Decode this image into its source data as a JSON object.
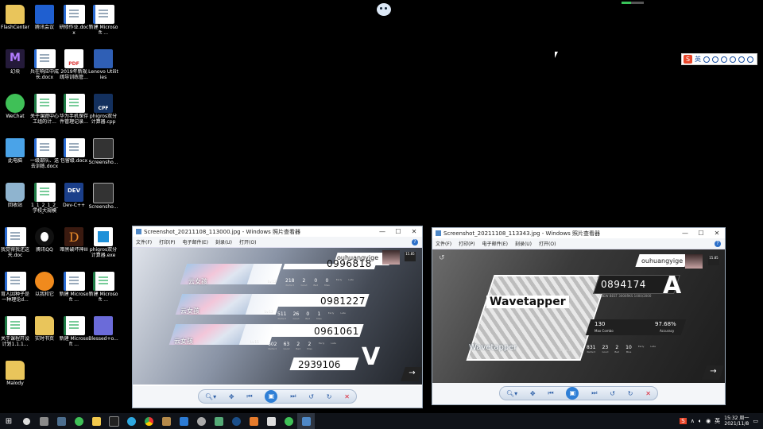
{
  "desktop_icons": [
    {
      "label": "FlashCenter",
      "icon": "flash-folder-icon"
    },
    {
      "label": "腾讯会议",
      "icon": "tencent-meeting-icon"
    },
    {
      "label": "研修作业.docx",
      "icon": "word-doc-icon"
    },
    {
      "label": "新建 Microsoft ...",
      "icon": "word-doc-icon"
    },
    {
      "label": "幻块",
      "icon": "app-icon"
    },
    {
      "label": "兵在响应中成长.docx",
      "icon": "word-doc-icon"
    },
    {
      "label": "2019年新规疏导训练管...",
      "icon": "pdf-icon"
    },
    {
      "label": "Lenovo Utilities",
      "icon": "lenovo-utilities-icon"
    },
    {
      "label": "WeChat",
      "icon": "wechat-icon"
    },
    {
      "label": "关于课题中心工组的计...",
      "icon": "excel-icon"
    },
    {
      "label": "华为手机保存件管理记录...",
      "icon": "excel-icon"
    },
    {
      "label": "phigros双分计算器.cpp",
      "icon": "cpp-file-icon"
    },
    {
      "label": "此电脑",
      "icon": "this-pc-icon"
    },
    {
      "label": "一级部队、送去训练.docx",
      "icon": "word-doc-icon"
    },
    {
      "label": "包留级.docx",
      "icon": "word-doc-icon"
    },
    {
      "label": "Screensho...",
      "icon": "screenshot-icon"
    },
    {
      "label": "回收站",
      "icon": "recycle-bin-icon"
    },
    {
      "label": "1_1_2_1_2_学校大规模投...",
      "icon": "excel-icon"
    },
    {
      "label": "Dev-C++",
      "icon": "dev-cpp-icon"
    },
    {
      "label": "Screensho...",
      "icon": "screenshot-icon"
    },
    {
      "label": "我觉得我还这天.doc",
      "icon": "word-doc-icon"
    },
    {
      "label": "腾讯QQ",
      "icon": "qq-icon"
    },
    {
      "label": "暗黑破坏神III",
      "icon": "diablo-icon"
    },
    {
      "label": "phigros双分计算器.exe",
      "icon": "exe-icon"
    },
    {
      "label": "育人因种子是一种理论d...",
      "icon": "word-doc-icon"
    },
    {
      "label": "以我和它",
      "icon": "orange-app-icon"
    },
    {
      "label": "新建 Microsoft ...",
      "icon": "word-doc-icon"
    },
    {
      "label": "新建 Microsoft ...",
      "icon": "excel-icon"
    },
    {
      "label": "关于课程开设计划1.1.1...",
      "icon": "excel-icon"
    },
    {
      "label": "实时书页",
      "icon": "folder-icon"
    },
    {
      "label": "新建 Microsoft ...",
      "icon": "excel-icon"
    },
    {
      "label": "Blessed+o...",
      "icon": "winrar-icon"
    },
    {
      "label": "Malody",
      "icon": "folder-icon"
    }
  ],
  "ime_bar": {
    "logo": "S",
    "lang": "英"
  },
  "viewer_left": {
    "title": "Screenshot_20211108_113000.jpg - Windows 照片查看器",
    "menu": [
      "文件(F)",
      "打印(P)",
      "电子邮件(E)",
      "刻录(U)",
      "打开(O)"
    ],
    "player": "ouhuangyige",
    "rks_badge": "15.85",
    "songs": [
      {
        "name": "云女孩",
        "level": "Lv.12",
        "score": "0996818",
        "stats": [
          {
            "v": "218",
            "k": "Perfect"
          },
          {
            "v": "2",
            "k": "Good"
          },
          {
            "v": "0",
            "k": "Bad"
          },
          {
            "v": "0",
            "k": "Miss"
          },
          {
            "v": "",
            "k": "Early"
          },
          {
            "v": "",
            "k": "Late"
          }
        ]
      },
      {
        "name": "云女孩",
        "level": "Lv.12",
        "score": "0981227",
        "stats": [
          {
            "v": "511",
            "k": "Perfect"
          },
          {
            "v": "26",
            "k": "Good"
          },
          {
            "v": "0",
            "k": "Bad"
          },
          {
            "v": "1",
            "k": "Miss"
          },
          {
            "v": "",
            "k": "Early"
          },
          {
            "v": "",
            "k": "Late"
          }
        ]
      },
      {
        "name": "云女孩",
        "level": "Lv.15",
        "score": "0961061",
        "stats": [
          {
            "v": "602",
            "k": "Perfect"
          },
          {
            "v": "63",
            "k": "Good"
          },
          {
            "v": "2",
            "k": "Bad"
          },
          {
            "v": "2",
            "k": "Miss"
          },
          {
            "v": "",
            "k": "Early"
          },
          {
            "v": "",
            "k": "Late"
          }
        ]
      }
    ],
    "rank": "V",
    "total": "2939106"
  },
  "viewer_right": {
    "title": "Screenshot_20211108_113343.jpg - Windows 照片查看器",
    "menu": [
      "文件(F)",
      "打印(P)",
      "电子邮件(E)",
      "刻录(U)",
      "打开(O)"
    ],
    "player": "ouhuangyige",
    "rks_badge": "15.85",
    "song_logo": "Wavetapper",
    "song_name": "Wavetapper",
    "level": "IN Lv.13",
    "score": "0894174",
    "score_sub": "NEW BEST  3000RKS  1000/2000",
    "rank": "A",
    "max_combo": "130",
    "max_combo_label": "Max Combo",
    "accuracy": "97.68%",
    "accuracy_label": "Accuracy",
    "stats": [
      {
        "v": "831",
        "k": "Perfect"
      },
      {
        "v": "23",
        "k": "Good"
      },
      {
        "v": "2",
        "k": "Bad"
      },
      {
        "v": "10",
        "k": "Miss"
      },
      {
        "v": "",
        "k": "Early"
      },
      {
        "v": "",
        "k": "Late"
      }
    ]
  },
  "taskbar": {
    "clock_time": "15:32 周一",
    "clock_date": "2021/11/8",
    "apps": [
      "start",
      "search",
      "cortana",
      "photo",
      "explorer",
      "wechat",
      "file-explorer",
      "game",
      "edge",
      "chrome",
      "box",
      "mail",
      "steam-like",
      "store",
      "steam",
      "origin",
      "wechat",
      "photos"
    ]
  }
}
